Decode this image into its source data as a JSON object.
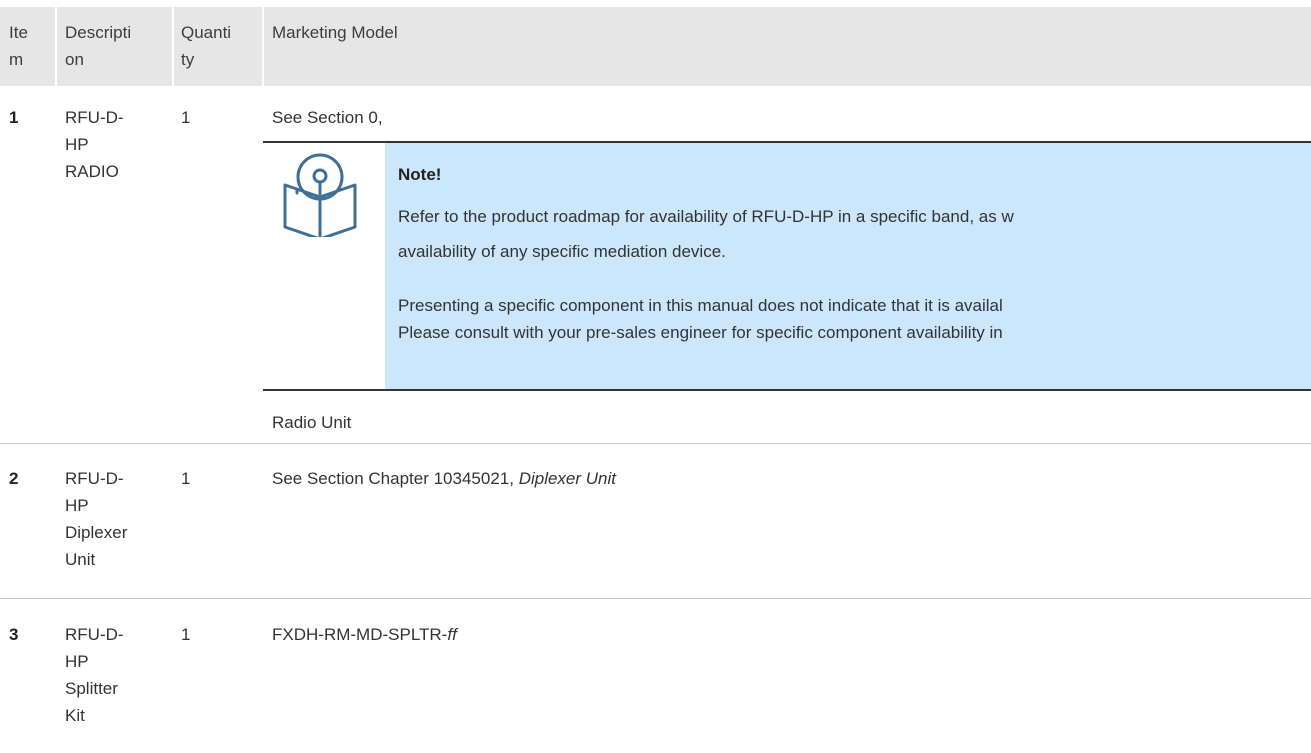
{
  "table": {
    "headers": {
      "item": [
        "Ite",
        "m"
      ],
      "description": [
        "Descripti",
        "on"
      ],
      "quantity": [
        "Quanti",
        "ty"
      ],
      "marketing_model": "Marketing Model"
    },
    "rows": [
      {
        "item": "1",
        "description": [
          "RFU-D-",
          "HP",
          "RADIO"
        ],
        "quantity": "1",
        "model_line": "See Section 0,",
        "model_after": "Radio Unit"
      },
      {
        "item": "2",
        "description": [
          "RFU-D-",
          "HP",
          "Diplexer",
          "Unit"
        ],
        "quantity": "1",
        "model_prefix": "See Section Chapter 10345021, ",
        "model_italic": "Diplexer Unit"
      },
      {
        "item": "3",
        "description": [
          "RFU-D-",
          "HP",
          "Splitter",
          "Kit"
        ],
        "quantity": "1",
        "model_prefix": "FXDH-RM-MD-SPLTR-",
        "model_italic": "ff"
      }
    ]
  },
  "note": {
    "icon": "book-note-icon",
    "title": "Note!",
    "lines": [
      "Refer to the product roadmap for availability of RFU-D-HP in a specific band, as w",
      "availability of any specific mediation device.",
      "Presenting a specific component in this manual does not indicate that it is availal",
      "Please consult with your pre-sales engineer for specific component availability in"
    ]
  },
  "colors": {
    "header_bg": "#e6e6e6",
    "note_bg": "#cce7fb",
    "icon_stroke": "#3f6f96"
  }
}
